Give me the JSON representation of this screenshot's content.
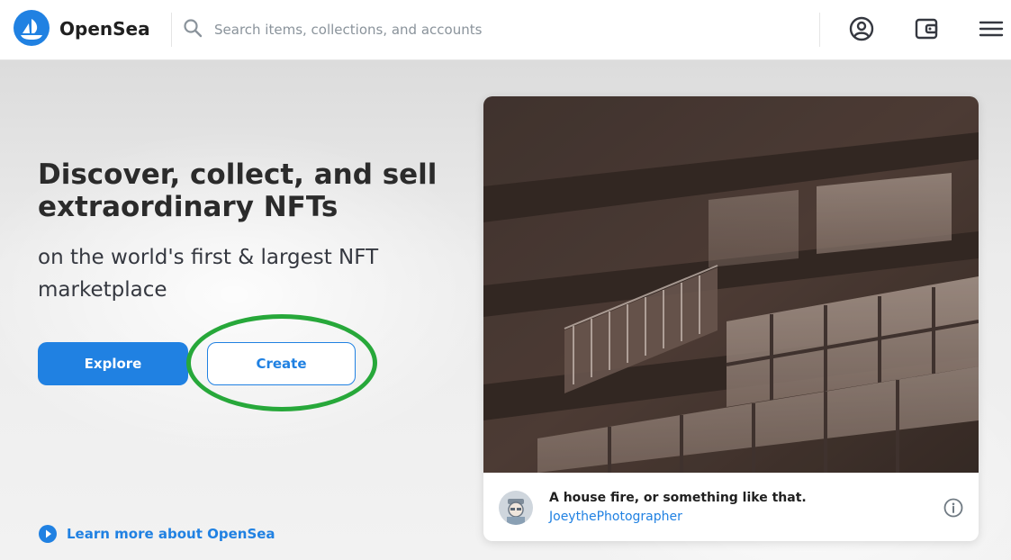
{
  "header": {
    "brand": "OpenSea",
    "search_placeholder": "Search items, collections, and accounts",
    "icons": [
      "opensea-logo-icon",
      "search-icon",
      "account-icon",
      "wallet-icon",
      "menu-icon"
    ]
  },
  "hero": {
    "headline": "Discover, collect, and sell extraordinary NFTs",
    "subheadline": "on the world's first & largest NFT marketplace",
    "explore_label": "Explore",
    "create_label": "Create",
    "learn_more_label": "Learn more about OpenSea"
  },
  "featured": {
    "title": "A house fire, or something like that.",
    "creator": "JoeythePhotographer"
  },
  "colors": {
    "accent": "#2081e2",
    "highlight": "#27a83a",
    "text_dark": "#2b2b2b"
  }
}
